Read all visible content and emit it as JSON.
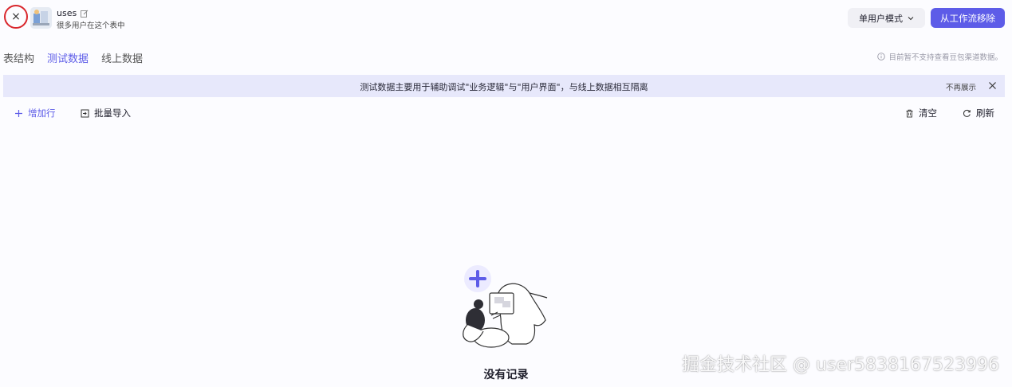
{
  "header": {
    "close_label": "×",
    "app_title": "uses",
    "app_subtitle": "很多用户在这个表中",
    "mode_select_label": "单用户模式",
    "remove_button_label": "从工作流移除"
  },
  "tabs": [
    {
      "label": "表结构",
      "active": false
    },
    {
      "label": "测试数据",
      "active": true
    },
    {
      "label": "线上数据",
      "active": false
    }
  ],
  "note": "目前暂不支持查看豆包渠道数据。",
  "banner": {
    "text": "测试数据主要用于辅助调试\"业务逻辑\"与\"用户界面\"，与线上数据相互隔离",
    "dismiss_label": "不再展示"
  },
  "toolbar": {
    "add_row_label": "增加行",
    "import_label": "批量导入",
    "clear_label": "清空",
    "refresh_label": "刷新"
  },
  "empty_state": {
    "text": "没有记录"
  },
  "watermark": "掘金技术社区 @ user5838167523996",
  "colors": {
    "accent": "#5d5ce8",
    "banner_bg": "#e7e8fb",
    "close_circle": "#d9262c"
  }
}
